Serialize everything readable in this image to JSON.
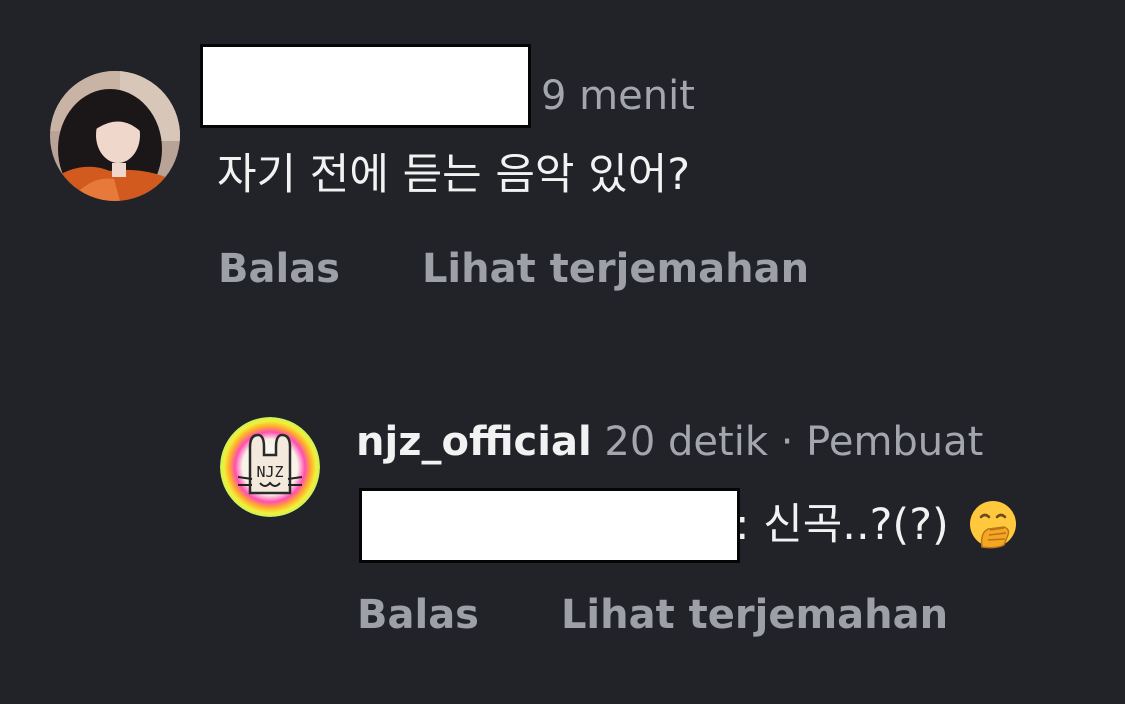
{
  "comment1": {
    "timestamp": "9 menit",
    "text": "자기 전에 듣는 음악 있어?",
    "actions": {
      "reply": "Balas",
      "translate": "Lihat terjemahan"
    }
  },
  "comment2": {
    "username": "njz_official",
    "timestamp": "20 detik",
    "separator": "·",
    "creator_badge": "Pembuat",
    "text": ": 신곡..?(?)",
    "emoji": "face-with-hand-over-mouth-icon",
    "actions": {
      "reply": "Balas",
      "translate": "Lihat terjemahan"
    }
  },
  "colors": {
    "background": "#222328",
    "primary_text": "#f2f2f2",
    "secondary_text": "#a4a6ad",
    "action_text": "#9ea0a7"
  }
}
